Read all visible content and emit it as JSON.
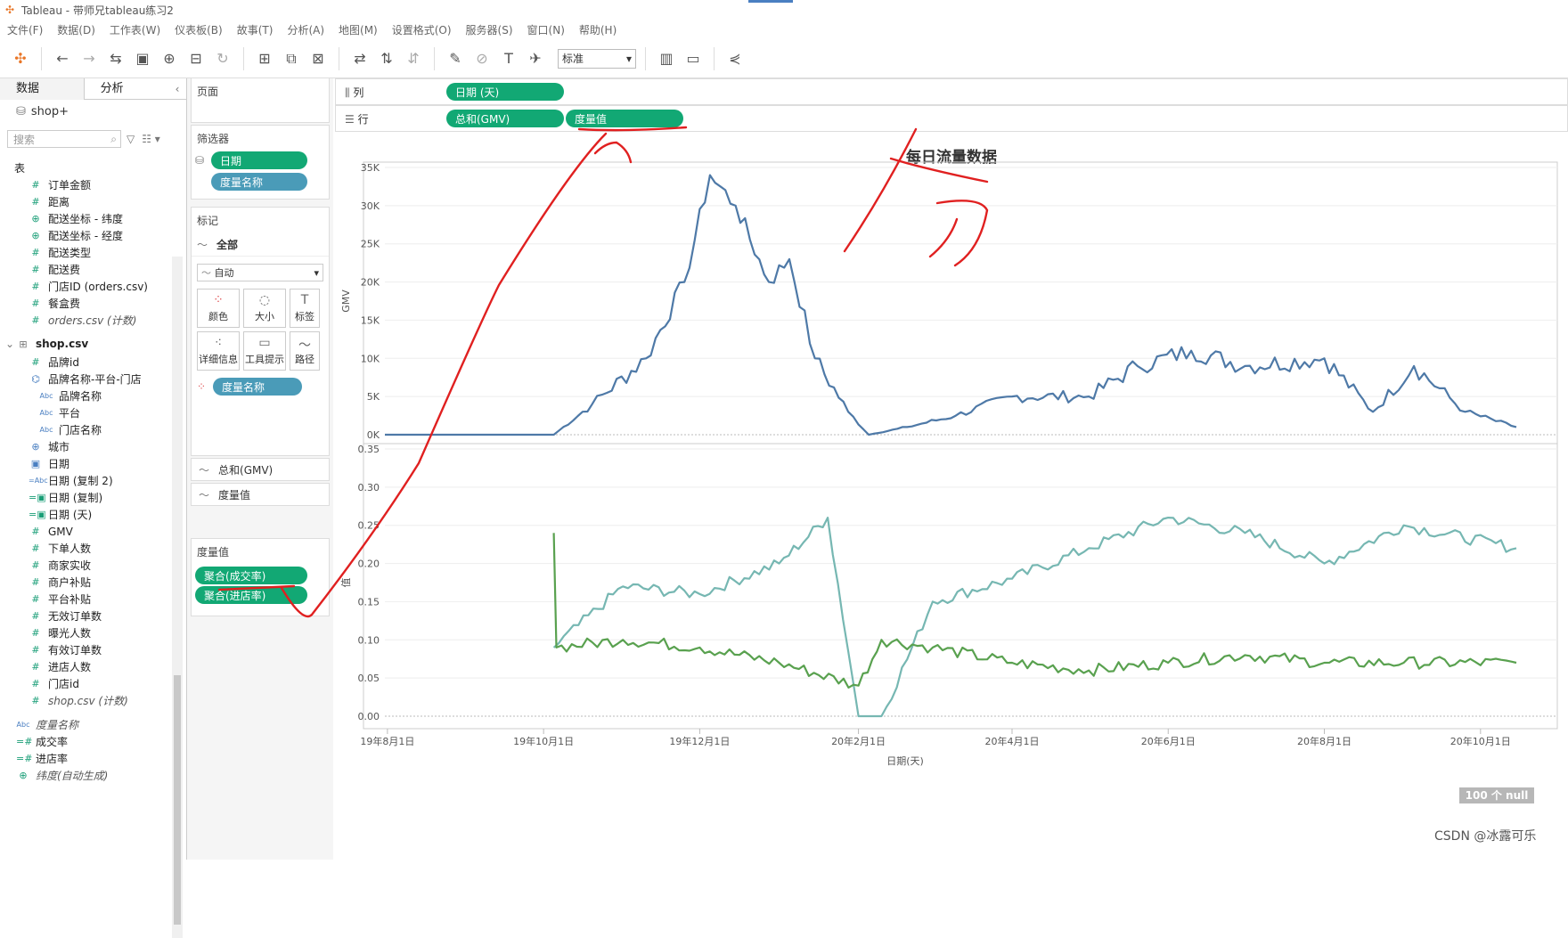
{
  "window": {
    "title": "Tableau - 带师兄tableau练习2"
  },
  "menu": [
    "文件(F)",
    "数据(D)",
    "工作表(W)",
    "仪表板(B)",
    "故事(T)",
    "分析(A)",
    "地图(M)",
    "设置格式(O)",
    "服务器(S)",
    "窗口(N)",
    "帮助(H)"
  ],
  "toolbar": {
    "fit_select": "标准"
  },
  "datapane": {
    "tab_data": "数据",
    "tab_analysis": "分析",
    "datasource": "shop+",
    "search_placeholder": "搜索",
    "table_header": "表",
    "orders_fields": [
      "订单金额",
      "距离",
      "配送坐标 - 纬度",
      "配送坐标 - 经度",
      "配送类型",
      "配送费",
      "门店ID (orders.csv)",
      "餐盒费",
      "orders.csv (计数)"
    ],
    "shop_table": "shop.csv",
    "shop_fields_a": [
      "品牌id",
      "品牌名称-平台-门店"
    ],
    "hier_children": [
      "品牌名称",
      "平台",
      "门店名称"
    ],
    "shop_fields_b": [
      "城市",
      "日期",
      "日期 (复制 2)",
      "日期 (复制)",
      "日期 (天)",
      "GMV",
      "下单人数",
      "商家实收",
      "商户补贴",
      "平台补贴",
      "无效订单数",
      "曝光人数",
      "有效订单数",
      "进店人数",
      "门店id",
      "shop.csv (计数)"
    ],
    "measure_names": "度量名称",
    "calc_fields": [
      "成交率",
      "进店率",
      "纬度(自动生成)"
    ]
  },
  "shelves": {
    "pages_label": "页面",
    "filters_label": "筛选器",
    "filters": [
      "日期",
      "度量名称"
    ],
    "marks_label": "标记",
    "marks_all": "全部",
    "marks_type": "自动",
    "mark_buttons": [
      "颜色",
      "大小",
      "标签",
      "详细信息",
      "工具提示",
      "路径"
    ],
    "marks_color_pill": "度量名称",
    "marks_sub": [
      "总和(GMV)",
      "度量值"
    ],
    "measure_values_label": "度量值",
    "measure_values": [
      "聚合(成交率)",
      "聚合(进店率)"
    ],
    "columns_label": "列",
    "columns": [
      "日期 (天)"
    ],
    "rows_label": "行",
    "rows": [
      "总和(GMV)",
      "度量值"
    ]
  },
  "chart_data": {
    "type": "line",
    "title": "每日流量数据",
    "xlabel": "日期(天)",
    "x_ticks": [
      "19年8月1日",
      "19年10月1日",
      "19年12月1日",
      "20年2月1日",
      "20年4月1日",
      "20年6月1日",
      "20年8月1日",
      "20年10月1日"
    ],
    "x_range": [
      "2019-07-31",
      "2020-10-31"
    ],
    "panes": [
      {
        "ylabel": "GMV",
        "ylim": [
          0,
          35000
        ],
        "y_ticks": [
          "0K",
          "5K",
          "10K",
          "15K",
          "20K",
          "25K",
          "30K",
          "35K"
        ],
        "series": [
          {
            "color": "#4e79a7",
            "key_points": [
              [
                "2019-07-31",
                0
              ],
              [
                "2019-10-05",
                0
              ],
              [
                "2019-10-20",
                4000
              ],
              [
                "2019-11-10",
                10000
              ],
              [
                "2019-11-25",
                20000
              ],
              [
                "2019-12-05",
                34000
              ],
              [
                "2019-12-15",
                30000
              ],
              [
                "2019-12-28",
                20000
              ],
              [
                "2020-01-05",
                23000
              ],
              [
                "2020-01-15",
                10000
              ],
              [
                "2020-01-28",
                3000
              ],
              [
                "2020-02-05",
                0
              ],
              [
                "2020-02-20",
                1000
              ],
              [
                "2020-03-10",
                2500
              ],
              [
                "2020-04-01",
                5000
              ],
              [
                "2020-05-01",
                5000
              ],
              [
                "2020-05-20",
                9000
              ],
              [
                "2020-06-10",
                11000
              ],
              [
                "2020-07-01",
                9000
              ],
              [
                "2020-08-01",
                10000
              ],
              [
                "2020-08-20",
                3000
              ],
              [
                "2020-09-05",
                9000
              ],
              [
                "2020-09-25",
                3000
              ],
              [
                "2020-10-15",
                1000
              ]
            ]
          }
        ]
      },
      {
        "ylabel": "值",
        "ylim": [
          0,
          0.35
        ],
        "y_ticks": [
          "0.00",
          "0.05",
          "0.10",
          "0.15",
          "0.20",
          "0.25",
          "0.30",
          "0.35"
        ],
        "series": [
          {
            "color": "#76b7b2",
            "key_points": [
              [
                "2019-10-05",
                0.09
              ],
              [
                "2019-11-01",
                0.17
              ],
              [
                "2019-12-01",
                0.16
              ],
              [
                "2020-01-01",
                0.2
              ],
              [
                "2020-01-20",
                0.26
              ],
              [
                "2020-02-01",
                0.0
              ],
              [
                "2020-02-10",
                0.0
              ],
              [
                "2020-03-01",
                0.15
              ],
              [
                "2020-04-01",
                0.18
              ],
              [
                "2020-05-01",
                0.22
              ],
              [
                "2020-06-01",
                0.26
              ],
              [
                "2020-07-01",
                0.24
              ],
              [
                "2020-08-01",
                0.2
              ],
              [
                "2020-09-01",
                0.25
              ],
              [
                "2020-10-15",
                0.22
              ]
            ]
          },
          {
            "color": "#59a14f",
            "key_points": [
              [
                "2019-10-05",
                0.24
              ],
              [
                "2019-10-06",
                0.09
              ],
              [
                "2019-11-01",
                0.1
              ],
              [
                "2019-12-01",
                0.09
              ],
              [
                "2020-01-01",
                0.07
              ],
              [
                "2020-02-01",
                0.04
              ],
              [
                "2020-02-10",
                0.1
              ],
              [
                "2020-03-01",
                0.09
              ],
              [
                "2020-04-01",
                0.07
              ],
              [
                "2020-05-01",
                0.06
              ],
              [
                "2020-06-01",
                0.07
              ],
              [
                "2020-07-01",
                0.08
              ],
              [
                "2020-08-01",
                0.07
              ],
              [
                "2020-09-01",
                0.07
              ],
              [
                "2020-10-15",
                0.07
              ]
            ]
          }
        ]
      }
    ],
    "null_badge": "100 个 null"
  },
  "watermark": "CSDN @冰露可乐",
  "colors": {
    "pill_green": "#12a874",
    "pill_blue": "#4a9bb8",
    "annotation": "#e02020"
  }
}
